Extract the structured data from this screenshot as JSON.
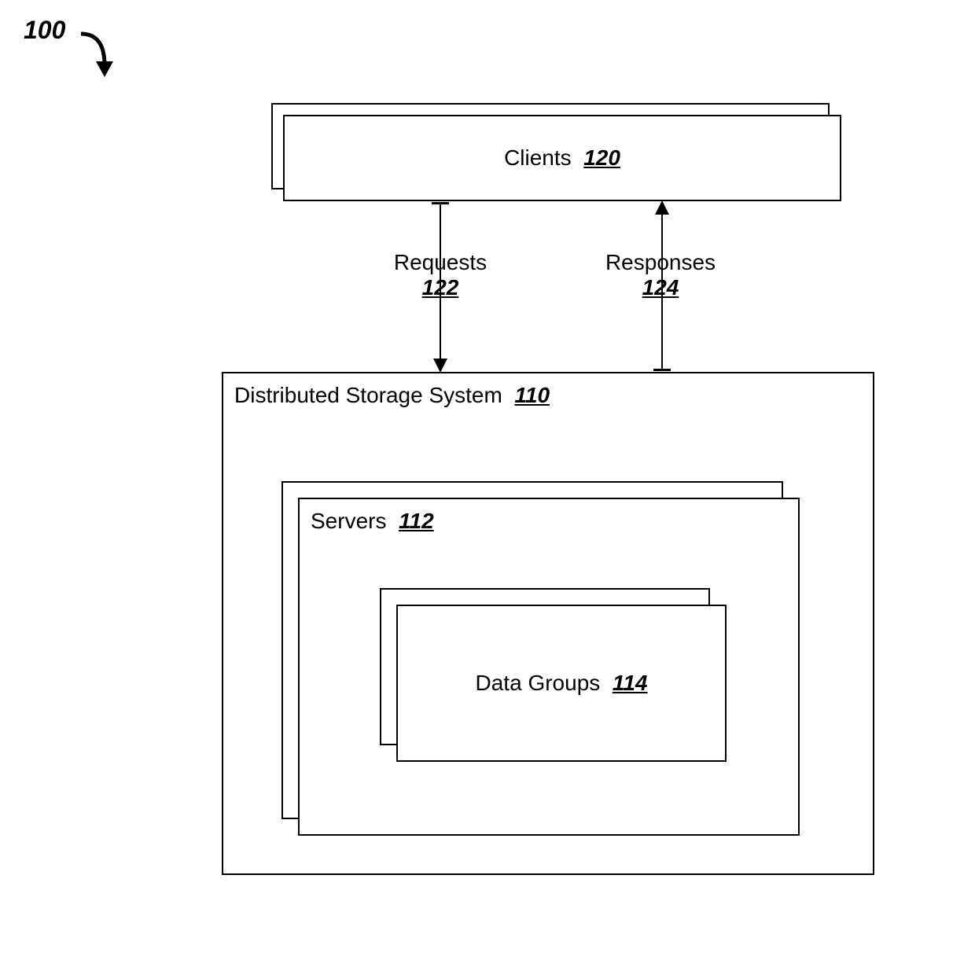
{
  "figure": {
    "number": "100"
  },
  "clients": {
    "label": "Clients",
    "ref": "120"
  },
  "requests": {
    "label": "Requests",
    "ref": "122"
  },
  "responses": {
    "label": "Responses",
    "ref": "124"
  },
  "storage_system": {
    "label": "Distributed Storage System",
    "ref": "110"
  },
  "servers": {
    "label": "Servers",
    "ref": "112"
  },
  "data_groups": {
    "label": "Data Groups",
    "ref": "114"
  }
}
